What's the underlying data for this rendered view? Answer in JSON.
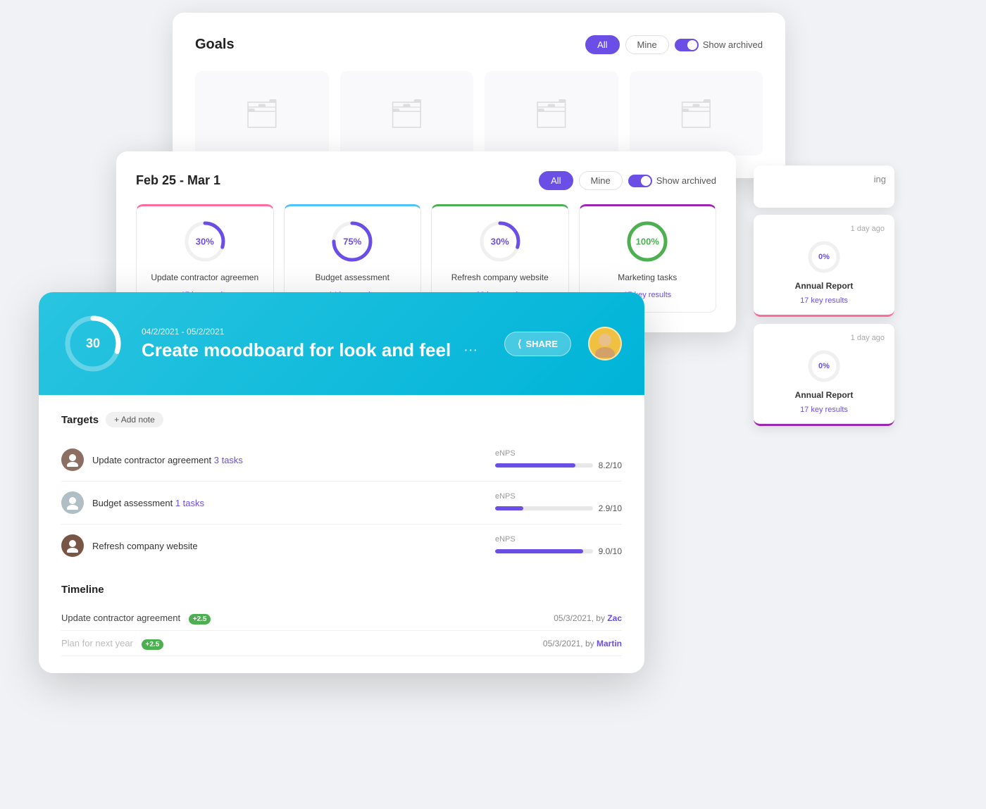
{
  "goalsPanel": {
    "title": "Goals",
    "filterAll": "All",
    "filterMine": "Mine",
    "filterToggle": "Show archived",
    "folders": [
      "folder1",
      "folder2",
      "folder3",
      "folder4"
    ]
  },
  "weeklyPanel": {
    "title": "Feb 25 - Mar 1",
    "filterAll": "All",
    "filterMine": "Mine",
    "filterToggle": "Show archived",
    "cards": [
      {
        "name": "Update contractor agreemen",
        "meta": "17 key results",
        "percent": 30,
        "color": "#ff6b9d",
        "colorClass": "pink",
        "ring": "#6b4ee6"
      },
      {
        "name": "Budget assessment",
        "meta": "14 key results",
        "percent": 75,
        "color": "#4fc3f7",
        "colorClass": "blue",
        "ring": "#6b4ee6"
      },
      {
        "name": "Refresh company website",
        "meta": "22 key results",
        "percent": 30,
        "color": "#4caf50",
        "colorClass": "green",
        "ring": "#6b4ee6"
      },
      {
        "name": "Marketing tasks",
        "meta": "17 key results",
        "percent": 100,
        "color": "#9c27b0",
        "colorClass": "purple",
        "ring": "#4caf50"
      }
    ]
  },
  "sidebarCards": [
    {
      "name": "Annual Report",
      "meta": "17 key results",
      "time": "1 day ago",
      "percent": 0,
      "bottomColor": "pink-bottom"
    },
    {
      "name": "Annual Report",
      "meta": "17 key results",
      "time": "1 day ago",
      "percent": 0,
      "bottomColor": "purple-bottom"
    }
  ],
  "detailPanel": {
    "dateRange": "04/2/2021 - 05/2/2021",
    "title": "Create moodboard for look and feel",
    "percent": 30,
    "shareLabel": "SHARE",
    "targetsTitle": "Targets",
    "addNoteLabel": "+ Add note",
    "targets": [
      {
        "name": "Update contractor agreement",
        "link": "3 tasks",
        "metric": "eNPS",
        "value": "8.2/10",
        "fillPct": 82
      },
      {
        "name": "Budget assessment",
        "link": "1 tasks",
        "metric": "eNPS",
        "value": "2.9/10",
        "fillPct": 29
      },
      {
        "name": "Refresh company website",
        "link": "",
        "metric": "eNPS",
        "value": "9.0/10",
        "fillPct": 90
      }
    ],
    "timelineTitle": "Timeline",
    "timelineItems": [
      {
        "name": "Update contractor agreement",
        "badge": "+2.5",
        "date": "05/3/2021, by",
        "by": "Zac",
        "byClass": "zac"
      },
      {
        "name": "Plan for next year",
        "badge": "+2.5",
        "date": "05/3/2021, by",
        "by": "Martin",
        "byClass": "martin"
      }
    ]
  }
}
